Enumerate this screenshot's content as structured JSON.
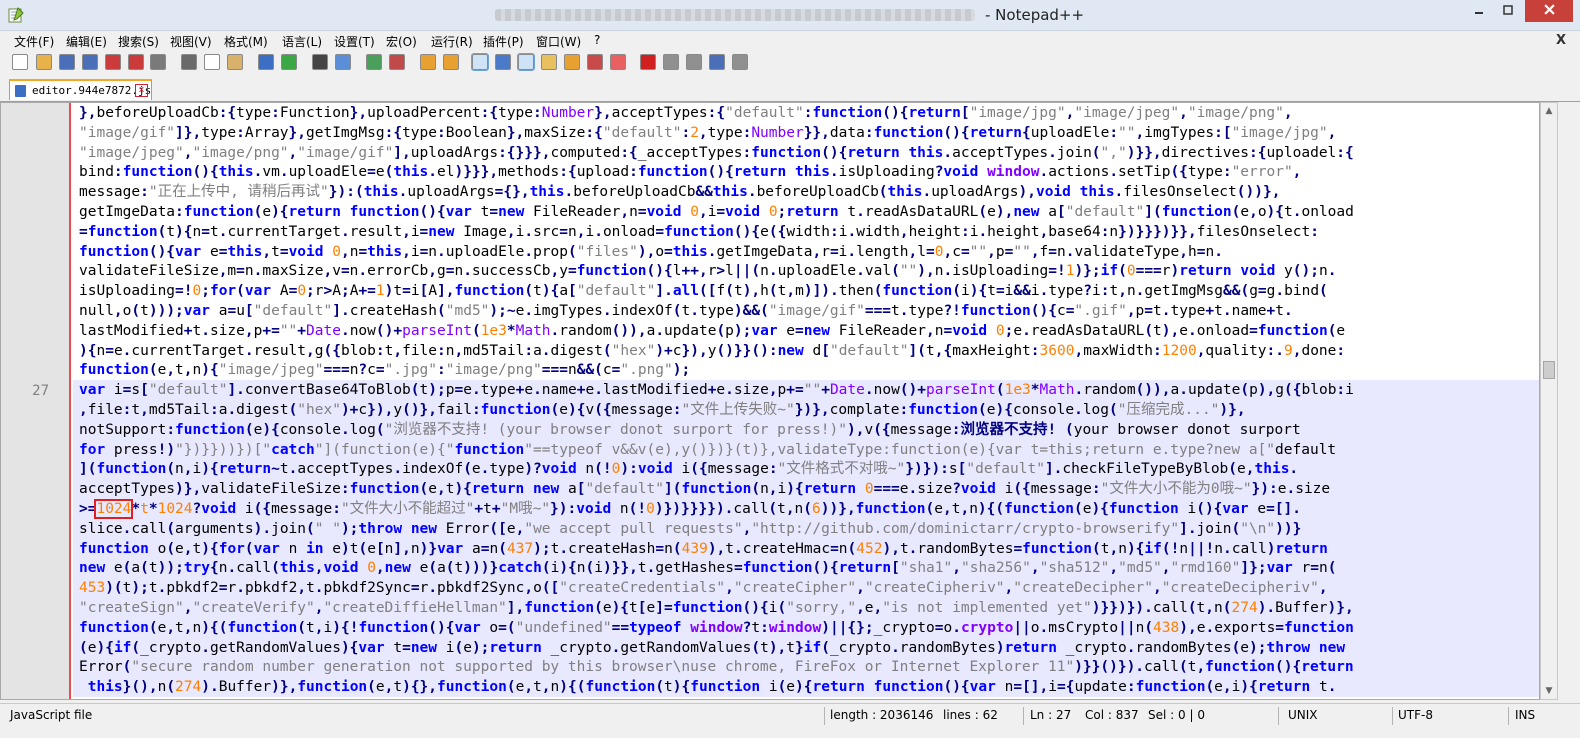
{
  "window": {
    "title": "- Notepad++"
  },
  "menu": [
    "文件(F)",
    "编辑(E)",
    "搜索(S)",
    "视图(V)",
    "格式(M)",
    "语言(L)",
    "设置(T)",
    "宏(O)",
    "运行(R)",
    "插件(P)",
    "窗口(W)",
    "?"
  ],
  "menu_close": "X",
  "toolbar_icons": [
    {
      "name": "new-file-icon",
      "color": "#ffffff"
    },
    {
      "name": "open-file-icon",
      "color": "#e8b24a"
    },
    {
      "name": "save-icon",
      "color": "#4a6fb8"
    },
    {
      "name": "save-all-icon",
      "color": "#4a6fb8"
    },
    {
      "name": "close-icon",
      "color": "#cc3b3b"
    },
    {
      "name": "close-all-icon",
      "color": "#cc3b3b"
    },
    {
      "name": "print-icon",
      "color": "#7a7a7a"
    },
    {
      "name": "cut-icon",
      "color": "#6a6a6a"
    },
    {
      "name": "copy-icon",
      "color": "#ffffff"
    },
    {
      "name": "paste-icon",
      "color": "#d8b26a"
    },
    {
      "name": "undo-icon",
      "color": "#3c6fc4"
    },
    {
      "name": "redo-icon",
      "color": "#3ca845"
    },
    {
      "name": "find-icon",
      "color": "#444444"
    },
    {
      "name": "replace-icon",
      "color": "#5a8fd8"
    },
    {
      "name": "zoom-in-icon",
      "color": "#4aa05a"
    },
    {
      "name": "zoom-out-icon",
      "color": "#c04a4a"
    },
    {
      "name": "sync-vertical-icon",
      "color": "#e8a030"
    },
    {
      "name": "sync-horizontal-icon",
      "color": "#e8a030"
    },
    {
      "name": "word-wrap-icon",
      "color": "#4a7ac8"
    },
    {
      "name": "show-all-chars-icon",
      "color": "#4a7ac8"
    },
    {
      "name": "indent-guide-icon",
      "color": "#4a7ac8"
    },
    {
      "name": "user-language-icon",
      "color": "#e8c060"
    },
    {
      "name": "document-map-icon",
      "color": "#e8a030"
    },
    {
      "name": "function-list-icon",
      "color": "#c84a4a"
    },
    {
      "name": "folder-as-workspace-icon",
      "color": "#e86060"
    },
    {
      "name": "record-macro-icon",
      "color": "#d02020"
    },
    {
      "name": "stop-record-icon",
      "color": "#909090"
    },
    {
      "name": "play-macro-icon",
      "color": "#909090"
    },
    {
      "name": "run-macro-multiple-icon",
      "color": "#4a6fb8"
    },
    {
      "name": "save-macro-icon",
      "color": "#909090"
    }
  ],
  "tab": {
    "label": "editor.944e7872.js",
    "close": "x"
  },
  "editor": {
    "current_line_number": "27",
    "colors": {
      "keyword": "#0000ff",
      "string": "#808080",
      "number": "#ff8000",
      "operator": "#000080",
      "identifier": "#000000",
      "window_word": "#8000ff",
      "current_line_bg": "#e8e8ff"
    },
    "lines": [
      "},beforeUploadCb:{type:Function},uploadPercent:{type:Number},acceptTypes:{\"default\":function(){return[\"image/jpg\",\"image/jpeg\",\"image/png\",",
      "\"image/gif\"]},type:Array},getImgMsg:{type:Boolean},maxSize:{\"default\":2,type:Number}},data:function(){return{uploadEle:\"\",imgTypes:[\"image/jpg\",",
      "\"image/jpeg\",\"image/png\",\"image/gif\"],uploadArgs:{}}},computed:{_acceptTypes:function(){return this.acceptTypes.join(\",\")}},directives:{uploadel:{",
      "bind:function(){this.vm.uploadEle=e(this.el)}}},methods:{upload:function(){return this.isUploading?void window.actions.setTip({type:\"error\",",
      "message:\"正在上传中, 请稍后再试\"}):(this.uploadArgs={},this.beforeUploadCb&&this.beforeUploadCb(this.uploadArgs),void this.filesOnselect())},",
      "getImgeData:function(e){return function(){var t=new FileReader,n=void 0,i=void 0;return t.readAsDataURL(e),new a[\"default\"](function(e,o){t.onload",
      "=function(t){n=t.currentTarget.result,i=new Image,i.src=n,i.onload=function(){e({width:i.width,height:i.height,base64:n})}}})}},filesOnselect:",
      "function(){var e=this,t=void 0,n=this,i=n.uploadEle.prop(\"files\"),o=this.getImgeData,r=i.length,l=0,c=\"\",p=\"\",f=n.validateType,h=n.",
      "validateFileSize,m=n.maxSize,v=n.errorCb,g=n.successCb,y=function(){l++,r>l||(n.uploadEle.val(\"\"),n.isUploading=!1)};if(0===r)return void y();n.",
      "isUploading=!0;for(var A=0;r>A;A+=1)t=i[A],function(t){a[\"default\"].all([f(t),h(t,m)]).then(function(i){t=i&&i.type?i:t,n.getImgMsg&&(g=g.bind(",
      "null,o(t)));var a=u[\"default\"].createHash(\"md5\");~e.imgTypes.indexOf(t.type)&&(\"image/gif\"===t.type?!function(){c=\".gif\",p=t.type+t.name+t.",
      "lastModified+t.size,p+=\"\"+Date.now()+parseInt(1e3*Math.random()),a.update(p);var e=new FileReader,n=void 0;e.readAsDataURL(t),e.onload=function(e",
      "){n=e.currentTarget.result,g({blob:t,file:n,md5Tail:a.digest(\"hex\")+c}),y()}}():new d[\"default\"](t,{maxHeight:3600,maxWidth:1200,quality:.9,done:",
      "function(e,t,n){\"image/jpeg\"===n?c=\".jpg\":\"image/png\"===n&&(c=\".png\");",
      "var i=s[\"default\"].convertBase64ToBlob(t);p=e.type+e.name+e.lastModified+e.size,p+=\"\"+Date.now()+parseInt(1e3*Math.random()),a.update(p),g({blob:i",
      ",file:t,md5Tail:a.digest(\"hex\")+c}),y()},fail:function(e){v({message:\"文件上传失败~\"})},complate:function(e){console.log(\"压缩完成...\")},",
      "notSupport:function(e){console.log(\"浏览器不支持! (your browser donot surport for press!)\"),v({message:\"浏览器不支持! (your browser donot surport",
      "for press!)\"})}}))})[\"catch\"](function(e){\"function\"==typeof v&&v(e),y()})}(t)},validateType:function(e){var t=this;return e.type?new a[\"default\"",
      "](function(n,i){return~t.acceptTypes.indexOf(e.type)?void n(!0):void i({message:\"文件格式不对哦~\"})}):s[\"default\"].checkFileTypeByBlob(e,this.",
      "acceptTypes)},validateFileSize:function(e,t){return new a[\"default\"](function(n,i){return 0===e.size?void i({message:\"文件大小不能为0哦~\"}):e.size",
      ">=1024*t*1024?void i({message:\"文件大小不能超过\"+t+\"M哦~\"}):void n(!0)})}}}}).call(t,n(6))},function(e,t,n){(function(e){function i(){var e=[].",
      "slice.call(arguments).join(\" \");throw new Error([e,\"we accept pull requests\",\"http://github.com/dominictarr/crypto-browserify\"].join(\"\\n\"))}",
      "function o(e,t){for(var n in e)t(e[n],n)}var a=n(437);t.createHash=n(439),t.createHmac=n(452),t.randomBytes=function(t,n){if(!n||!n.call)return",
      "new e(a(t));try{n.call(this,void 0,new e(a(t)))}catch(i){n(i)}},t.getHashes=function(){return[\"sha1\",\"sha256\",\"sha512\",\"md5\",\"rmd160\"]};var r=n(",
      "453)(t);t.pbkdf2=r.pbkdf2,t.pbkdf2Sync=r.pbkdf2Sync,o([\"createCredentials\",\"createCipher\",\"createCipheriv\",\"createDecipher\",\"createDecipheriv\",",
      "\"createSign\",\"createVerify\",\"createDiffieHellman\"],function(e){t[e]=function(){i(\"sorry,\",e,\"is not implemented yet\")}})}).call(t,n(274).Buffer)},",
      "function(e,t,n){(function(t,i){!function(){var o=(\"undefined\"==typeof window?t:window)||{};_crypto=o.crypto||o.msCrypto||n(438),e.exports=function",
      "(e){if(_crypto.getRandomValues){var t=new i(e);return _crypto.getRandomValues(t),t}if(_crypto.randomBytes)return _crypto.randomBytes(e);throw new",
      "Error(\"secure random number generation not supported by this browser\\nuse chrome, FireFox or Internet Explorer 11\")}}()}).call(t,function(){return",
      " this}(),n(274).Buffer)},function(e,t){},function(e,t,n){(function(t){function i(e){return function(){var n=[],i={update:function(e,i){return t."
    ]
  },
  "status": {
    "filetype": "JavaScript file",
    "length": "length : 2036146",
    "lines": "lines : 62",
    "ln": "Ln : 27",
    "col": "Col : 837",
    "sel": "Sel : 0 | 0",
    "eol": "UNIX",
    "encoding": "UTF-8",
    "mode": "INS"
  }
}
